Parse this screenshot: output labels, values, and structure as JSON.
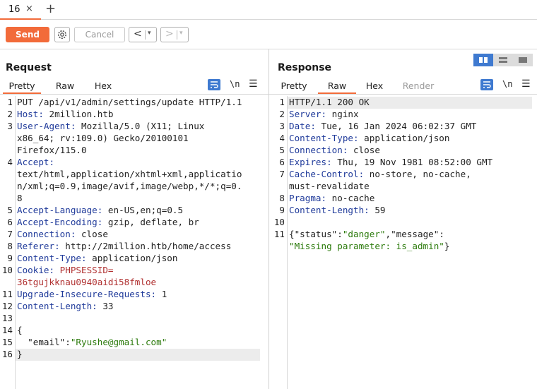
{
  "tabs": [
    {
      "label": "16",
      "close": "×"
    }
  ],
  "tab_add": "+",
  "toolbar": {
    "send": "Send",
    "cancel": "Cancel",
    "back": "<",
    "forward": ">",
    "caret": "▾"
  },
  "request": {
    "title": "Request",
    "subtabs": [
      "Pretty",
      "Raw",
      "Hex"
    ],
    "active_tab": "Pretty",
    "icons": {
      "wrap": "wrap-icon",
      "newline": "\\n",
      "menu": "☰"
    },
    "lines": [
      {
        "n": "1",
        "text": "PUT /api/v1/admin/settings/update HTTP/1.1"
      },
      {
        "n": "2",
        "key": "Host:",
        "val": " 2million.htb"
      },
      {
        "n": "3",
        "key": "User-Agent:",
        "val": " Mozilla/5.0 (X11; Linux"
      },
      {
        "n": "",
        "val": "x86_64; rv:109.0) Gecko/20100101"
      },
      {
        "n": "",
        "val": "Firefox/115.0"
      },
      {
        "n": "4",
        "key": "Accept:",
        "val": ""
      },
      {
        "n": "",
        "val": "text/html,application/xhtml+xml,applicatio"
      },
      {
        "n": "",
        "val": "n/xml;q=0.9,image/avif,image/webp,*/*;q=0."
      },
      {
        "n": "",
        "val": "8"
      },
      {
        "n": "5",
        "key": "Accept-Language:",
        "val": " en-US,en;q=0.5"
      },
      {
        "n": "6",
        "key": "Accept-Encoding:",
        "val": " gzip, deflate, br"
      },
      {
        "n": "7",
        "key": "Connection:",
        "val": " close"
      },
      {
        "n": "8",
        "key": "Referer:",
        "val": " http://2million.htb/home/access"
      },
      {
        "n": "9",
        "key": "Content-Type:",
        "val": " application/json"
      },
      {
        "n": "10",
        "key": "Cookie:",
        "cookie": " PHPSESSID="
      },
      {
        "n": "",
        "cookie": "36tgujkknau0940aidi58fmloe"
      },
      {
        "n": "11",
        "key": "Upgrade-Insecure-Requests:",
        "val": " 1"
      },
      {
        "n": "12",
        "key": "Content-Length:",
        "val": " 33"
      },
      {
        "n": "13",
        "val": ""
      },
      {
        "n": "14",
        "val": "{"
      },
      {
        "n": "15",
        "val": "  \"email\":",
        "str": "\"Ryushe@gmail.com\""
      },
      {
        "n": "16",
        "val": "}"
      }
    ]
  },
  "response": {
    "title": "Response",
    "subtabs": [
      "Pretty",
      "Raw",
      "Hex",
      "Render"
    ],
    "active_tab": "Raw",
    "icons": {
      "wrap": "wrap-icon",
      "newline": "\\n",
      "menu": "☰"
    },
    "lines": [
      {
        "n": "1",
        "text": "HTTP/1.1 200 OK"
      },
      {
        "n": "2",
        "key": "Server:",
        "val": " nginx"
      },
      {
        "n": "3",
        "key": "Date:",
        "val": " Tue, 16 Jan 2024 06:02:37 GMT"
      },
      {
        "n": "4",
        "key": "Content-Type:",
        "val": " application/json"
      },
      {
        "n": "5",
        "key": "Connection:",
        "val": " close"
      },
      {
        "n": "6",
        "key": "Expires:",
        "val": " Thu, 19 Nov 1981 08:52:00 GMT"
      },
      {
        "n": "7",
        "key": "Cache-Control:",
        "val": " no-store, no-cache,"
      },
      {
        "n": "",
        "val": "must-revalidate"
      },
      {
        "n": "8",
        "key": "Pragma:",
        "val": " no-cache"
      },
      {
        "n": "9",
        "key": "Content-Length:",
        "val": " 59"
      },
      {
        "n": "10",
        "val": ""
      },
      {
        "n": "11",
        "json1": "{\"status\":",
        "json1s": "\"danger\"",
        "json2": ",\"message\":"
      },
      {
        "n": "",
        "str": "\"Missing parameter: is_admin\"",
        "tail": "}"
      }
    ]
  },
  "colors": {
    "accent": "#f26b3a",
    "header_key": "#1f3a9a",
    "string": "#2b7a0b",
    "cookie": "#b03030",
    "wrap_active": "#3f7ad0"
  }
}
